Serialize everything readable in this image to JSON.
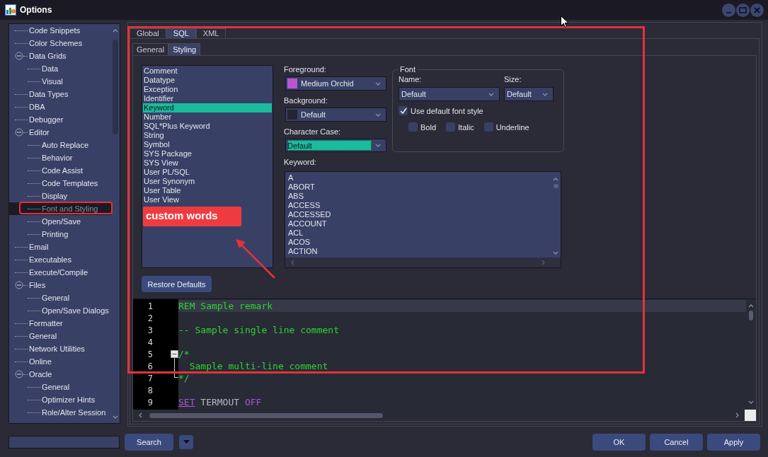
{
  "window": {
    "title": "Options"
  },
  "tree": {
    "items": [
      {
        "label": "Code Snippets",
        "selected": false
      },
      {
        "label": "Color Schemes",
        "selected": false
      },
      {
        "label": "Data Grids",
        "selected": false,
        "expanded": true,
        "children": [
          {
            "label": "Data",
            "selected": false
          },
          {
            "label": "Visual",
            "selected": false
          }
        ]
      },
      {
        "label": "Data Types",
        "selected": false
      },
      {
        "label": "DBA",
        "selected": false
      },
      {
        "label": "Debugger",
        "selected": false
      },
      {
        "label": "Editor",
        "selected": false,
        "expanded": true,
        "children": [
          {
            "label": "Auto Replace",
            "selected": false
          },
          {
            "label": "Behavior",
            "selected": false
          },
          {
            "label": "Code Assist",
            "selected": false
          },
          {
            "label": "Code Templates",
            "selected": false
          },
          {
            "label": "Display",
            "selected": false
          },
          {
            "label": "Font and Styling",
            "selected": true
          },
          {
            "label": "Open/Save",
            "selected": false
          },
          {
            "label": "Printing",
            "selected": false
          }
        ]
      },
      {
        "label": "Email",
        "selected": false
      },
      {
        "label": "Executables",
        "selected": false
      },
      {
        "label": "Execute/Compile",
        "selected": false
      },
      {
        "label": "Files",
        "selected": false,
        "expanded": true,
        "children": [
          {
            "label": "General",
            "selected": false
          },
          {
            "label": "Open/Save Dialogs",
            "selected": false
          }
        ]
      },
      {
        "label": "Formatter",
        "selected": false
      },
      {
        "label": "General",
        "selected": false
      },
      {
        "label": "Network Utilities",
        "selected": false
      },
      {
        "label": "Online",
        "selected": false
      },
      {
        "label": "Oracle",
        "selected": false,
        "expanded": true,
        "children": [
          {
            "label": "General",
            "selected": false
          },
          {
            "label": "Optimizer Hints",
            "selected": false
          },
          {
            "label": "Role/Alter Session",
            "selected": false
          }
        ]
      }
    ]
  },
  "tabs": [
    {
      "label": "Global",
      "selected": false
    },
    {
      "label": "SQL",
      "selected": true
    },
    {
      "label": "XML",
      "selected": false
    }
  ],
  "subtabs": [
    {
      "label": "General",
      "selected": false
    },
    {
      "label": "Styling",
      "selected": true
    }
  ],
  "styles": [
    {
      "label": "Comment",
      "selected": false
    },
    {
      "label": "Datatype",
      "selected": false
    },
    {
      "label": "Exception",
      "selected": false
    },
    {
      "label": "Identifier",
      "selected": false
    },
    {
      "label": "Keyword",
      "selected": true
    },
    {
      "label": "Number",
      "selected": false
    },
    {
      "label": "SQL*Plus Keyword",
      "selected": false
    },
    {
      "label": "String",
      "selected": false
    },
    {
      "label": "Symbol",
      "selected": false
    },
    {
      "label": "SYS Package",
      "selected": false
    },
    {
      "label": "SYS View",
      "selected": false
    },
    {
      "label": "User PL/SQL",
      "selected": false
    },
    {
      "label": "User Synonym",
      "selected": false
    },
    {
      "label": "User Table",
      "selected": false
    },
    {
      "label": "User View",
      "selected": false
    }
  ],
  "colors": [
    {
      "label": "Foreground:",
      "value": "Medium Orchid",
      "color": "#ba55d3"
    },
    {
      "label": "Background:",
      "value": "Default",
      "color": "#24252f"
    }
  ],
  "character_case": {
    "label": "Character Case:",
    "value": "Default",
    "focused": true
  },
  "font": {
    "legend": "Font",
    "name_label": "Name:",
    "name_value": "Default",
    "size_label": "Size:",
    "size_value": "Default",
    "use_default": {
      "label": "Use default font style",
      "checked": true
    },
    "styles": [
      {
        "label": "Bold",
        "checked": false
      },
      {
        "label": "Italic",
        "checked": false
      },
      {
        "label": "Underline",
        "checked": false
      }
    ]
  },
  "keywords": {
    "label": "Keyword:",
    "items": [
      "A",
      "ABORT",
      "ABS",
      "ACCESS",
      "ACCESSED",
      "ACCOUNT",
      "ACL",
      "ACOS",
      "ACTION"
    ]
  },
  "restore_button": "Restore Defaults",
  "editor": {
    "lines": [
      {
        "number": "1",
        "kind": "plain",
        "current": true,
        "tokens": [
          {
            "kind": "comment",
            "text": "REM Sample remark",
            "underlined": false
          }
        ]
      },
      {
        "number": "2",
        "kind": "plain",
        "current": false
      },
      {
        "number": "3",
        "kind": "plain",
        "current": false,
        "tokens": [
          {
            "kind": "comment",
            "text": "-- Sample single line comment",
            "underlined": false
          }
        ]
      },
      {
        "number": "4",
        "kind": "plain",
        "current": false
      },
      {
        "number": "5",
        "kind": "fold-start",
        "current": false,
        "tokens": [
          {
            "kind": "comment",
            "text": "/*",
            "underlined": false
          }
        ]
      },
      {
        "number": "6",
        "kind": "fold-inside",
        "current": false,
        "tokens": [
          {
            "kind": "comment",
            "text": "  Sample multi-line comment",
            "underlined": false
          }
        ]
      },
      {
        "number": "7",
        "kind": "fold-end",
        "current": false,
        "tokens": [
          {
            "kind": "comment",
            "text": "*/",
            "underlined": false
          }
        ]
      },
      {
        "number": "8",
        "kind": "plain",
        "current": false
      },
      {
        "number": "9",
        "kind": "plain",
        "current": false,
        "tokens": [
          {
            "kind": "keyword",
            "text": "SET",
            "underlined": true
          },
          {
            "kind": "plain",
            "text": "TERMOUT",
            "underlined": false
          },
          {
            "kind": "keyword",
            "text": "OFF",
            "underlined": false
          }
        ]
      }
    ]
  },
  "search_button": "Search",
  "buttons": [
    "OK",
    "Cancel",
    "Apply"
  ],
  "annotation": {
    "label": "custom words"
  }
}
